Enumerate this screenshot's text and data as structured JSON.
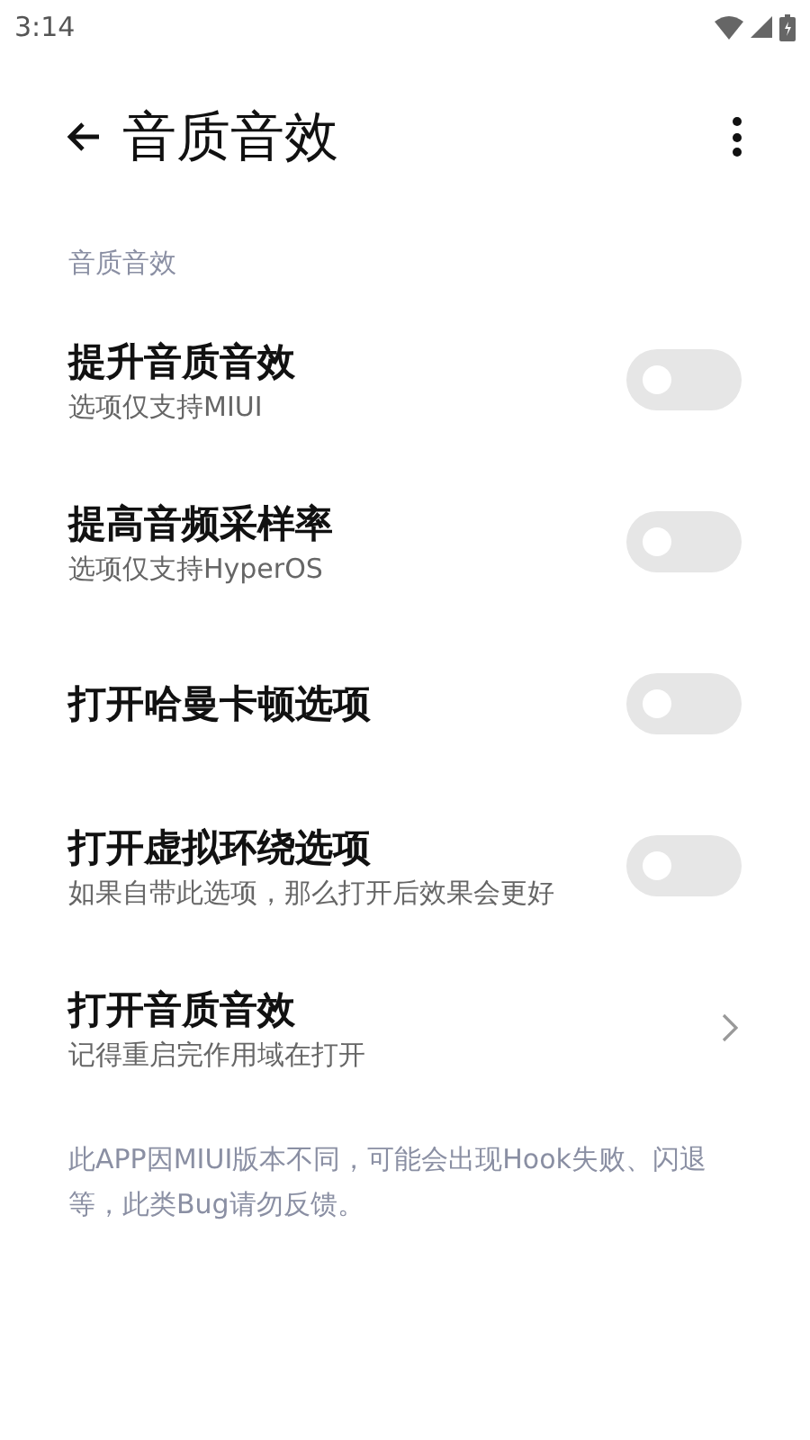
{
  "status_bar": {
    "time": "3:14"
  },
  "header": {
    "title": "音质音效"
  },
  "section": {
    "title": "音质音效"
  },
  "items": [
    {
      "kind": "switch",
      "title": "提升音质音效",
      "subtitle": "选项仅支持MIUI",
      "on": false
    },
    {
      "kind": "switch",
      "title": "提高音频采样率",
      "subtitle": "选项仅支持HyperOS",
      "on": false
    },
    {
      "kind": "switch",
      "title": "打开哈曼卡顿选项",
      "on": false
    },
    {
      "kind": "switch",
      "title": "打开虚拟环绕选项",
      "subtitle": "如果自带此选项，那么打开后效果会更好",
      "on": false
    },
    {
      "kind": "link",
      "title": "打开音质音效",
      "subtitle": "记得重启完作用域在打开"
    }
  ],
  "note": "此APP因MIUI版本不同，可能会出现Hook失败、闪退等，此类Bug请勿反馈。"
}
